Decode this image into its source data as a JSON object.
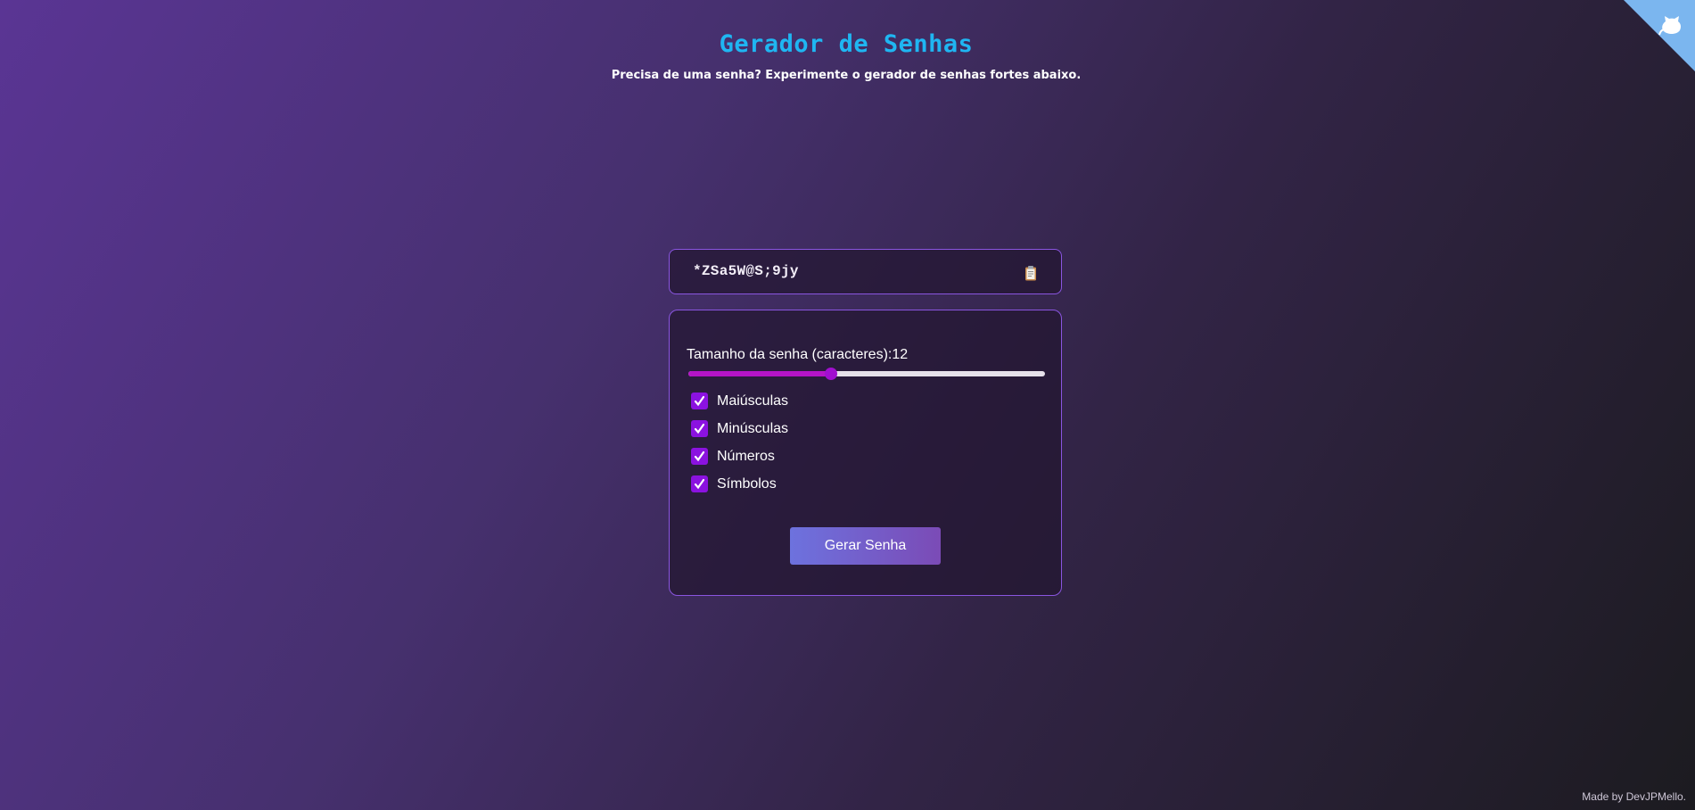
{
  "header": {
    "title": "Gerador de Senhas",
    "subtitle": "Precisa de uma senha? Experimente o gerador de senhas fortes abaixo."
  },
  "password": {
    "value": "*ZSa5W@S;9jy",
    "copy_icon": "clipboard-icon"
  },
  "settings": {
    "length_label": "Tamanho da senha (caracteres):",
    "length_value": "12",
    "slider": {
      "min": 4,
      "max": 24,
      "value": 12
    },
    "options": [
      {
        "label": "Maiúsculas",
        "checked": true
      },
      {
        "label": "Minúsculas",
        "checked": true
      },
      {
        "label": "Números",
        "checked": true
      },
      {
        "label": "Símbolos",
        "checked": true
      }
    ],
    "generate_label": "Gerar Senha"
  },
  "footer": {
    "credit": "Made by DevJPMello."
  },
  "colors": {
    "title": "#1fb6f2",
    "accent": "#8b12e0",
    "slider_fill": "#b514c7",
    "border": "#8a55e0",
    "corner_ribbon": "#7bb6ef"
  },
  "corner": {
    "icon": "github-cat-icon"
  }
}
